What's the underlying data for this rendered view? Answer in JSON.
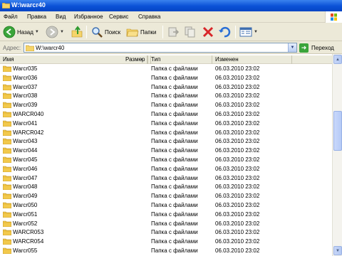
{
  "window": {
    "title": "W:\\warcr40"
  },
  "menu": {
    "items": [
      "Файл",
      "Правка",
      "Вид",
      "Избранное",
      "Сервис",
      "Справка"
    ]
  },
  "toolbar": {
    "back_label": "Назад",
    "search_label": "Поиск",
    "folders_label": "Папки",
    "icons": [
      "back-arrow-icon",
      "forward-arrow-icon",
      "up-folder-icon",
      "search-icon",
      "folders-icon",
      "move-to-icon",
      "copy-to-icon",
      "delete-icon",
      "undo-icon",
      "views-icon"
    ]
  },
  "address": {
    "label": "Адрес:",
    "value": "W:\\warcr40",
    "go_label": "Переход"
  },
  "list": {
    "columns": [
      "Имя",
      "Размер",
      "Тип",
      "Изменен"
    ],
    "rows": [
      {
        "name": "Warcr035",
        "size": "",
        "type": "Папка с файлами",
        "modified": "06.03.2010 23:02"
      },
      {
        "name": "Warcr036",
        "size": "",
        "type": "Папка с файлами",
        "modified": "06.03.2010 23:02"
      },
      {
        "name": "Warcr037",
        "size": "",
        "type": "Папка с файлами",
        "modified": "06.03.2010 23:02"
      },
      {
        "name": "Warcr038",
        "size": "",
        "type": "Папка с файлами",
        "modified": "06.03.2010 23:02"
      },
      {
        "name": "Warcr039",
        "size": "",
        "type": "Папка с файлами",
        "modified": "06.03.2010 23:02"
      },
      {
        "name": "WARCR040",
        "size": "",
        "type": "Папка с файлами",
        "modified": "06.03.2010 23:02"
      },
      {
        "name": "Warcr041",
        "size": "",
        "type": "Папка с файлами",
        "modified": "06.03.2010 23:02"
      },
      {
        "name": "WARCR042",
        "size": "",
        "type": "Папка с файлами",
        "modified": "06.03.2010 23:02"
      },
      {
        "name": "Warcr043",
        "size": "",
        "type": "Папка с файлами",
        "modified": "06.03.2010 23:02"
      },
      {
        "name": "Warcr044",
        "size": "",
        "type": "Папка с файлами",
        "modified": "06.03.2010 23:02"
      },
      {
        "name": "Warcr045",
        "size": "",
        "type": "Папка с файлами",
        "modified": "06.03.2010 23:02"
      },
      {
        "name": "Warcr046",
        "size": "",
        "type": "Папка с файлами",
        "modified": "06.03.2010 23:02"
      },
      {
        "name": "Warcr047",
        "size": "",
        "type": "Папка с файлами",
        "modified": "06.03.2010 23:02"
      },
      {
        "name": "Warcr048",
        "size": "",
        "type": "Папка с файлами",
        "modified": "06.03.2010 23:02"
      },
      {
        "name": "Warcr049",
        "size": "",
        "type": "Папка с файлами",
        "modified": "06.03.2010 23:02"
      },
      {
        "name": "Warcr050",
        "size": "",
        "type": "Папка с файлами",
        "modified": "06.03.2010 23:02"
      },
      {
        "name": "Warcr051",
        "size": "",
        "type": "Папка с файлами",
        "modified": "06.03.2010 23:02"
      },
      {
        "name": "Warcr052",
        "size": "",
        "type": "Папка с файлами",
        "modified": "06.03.2010 23:02"
      },
      {
        "name": "WARCR053",
        "size": "",
        "type": "Папка с файлами",
        "modified": "06.03.2010 23:02"
      },
      {
        "name": "WARCR054",
        "size": "",
        "type": "Папка с файлами",
        "modified": "06.03.2010 23:02"
      },
      {
        "name": "Warcr055",
        "size": "",
        "type": "Папка с файлами",
        "modified": "06.03.2010 23:02"
      }
    ]
  },
  "colors": {
    "titlebar": "#0a50d6",
    "chrome": "#ece9d8",
    "folder": "#f2c94c"
  }
}
